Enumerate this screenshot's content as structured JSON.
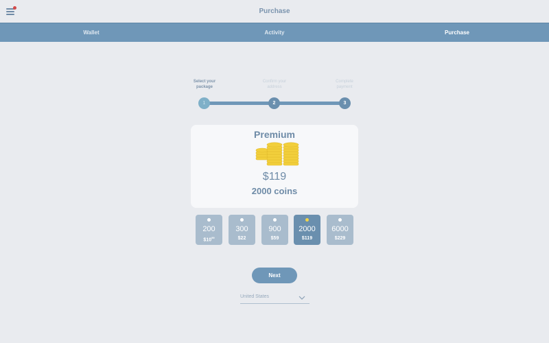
{
  "header": {
    "title": "Purchase",
    "menu_icon": "hamburger-menu-icon",
    "notification_color": "#d34a4a"
  },
  "tabs": [
    {
      "label": "Wallet",
      "active": false
    },
    {
      "label": "Activity",
      "active": false
    },
    {
      "label": "Purchase",
      "active": true
    }
  ],
  "stepper": {
    "steps": [
      {
        "number": "1",
        "label_line1": "Select your",
        "label_line2": "package",
        "state": "active"
      },
      {
        "number": "2",
        "label_line1": "Confirm your",
        "label_line2": "address",
        "state": "inactive"
      },
      {
        "number": "3",
        "label_line1": "Complete",
        "label_line2": "payment",
        "state": "inactive"
      }
    ]
  },
  "selected_package": {
    "name": "Premium",
    "price": "$119",
    "coins": "2000 coins",
    "icon": "coin-stacks-icon"
  },
  "packages": [
    {
      "amount": "200",
      "price": "$10",
      "price_sup": "99",
      "selected": false
    },
    {
      "amount": "300",
      "price": "$22",
      "price_sup": "",
      "selected": false
    },
    {
      "amount": "900",
      "price": "$59",
      "price_sup": "",
      "selected": false
    },
    {
      "amount": "2000",
      "price": "$119",
      "price_sup": "",
      "selected": true
    },
    {
      "amount": "6000",
      "price": "$229",
      "price_sup": "",
      "selected": false
    }
  ],
  "actions": {
    "next_label": "Next"
  },
  "country_select": {
    "value": "United States",
    "icon": "chevron-down-icon"
  },
  "colors": {
    "accent": "#6f97b8",
    "tile": "#a9bccd",
    "tile_selected": "#6a8fae",
    "coin": "#f2cf3c",
    "background": "#e9ebef"
  }
}
